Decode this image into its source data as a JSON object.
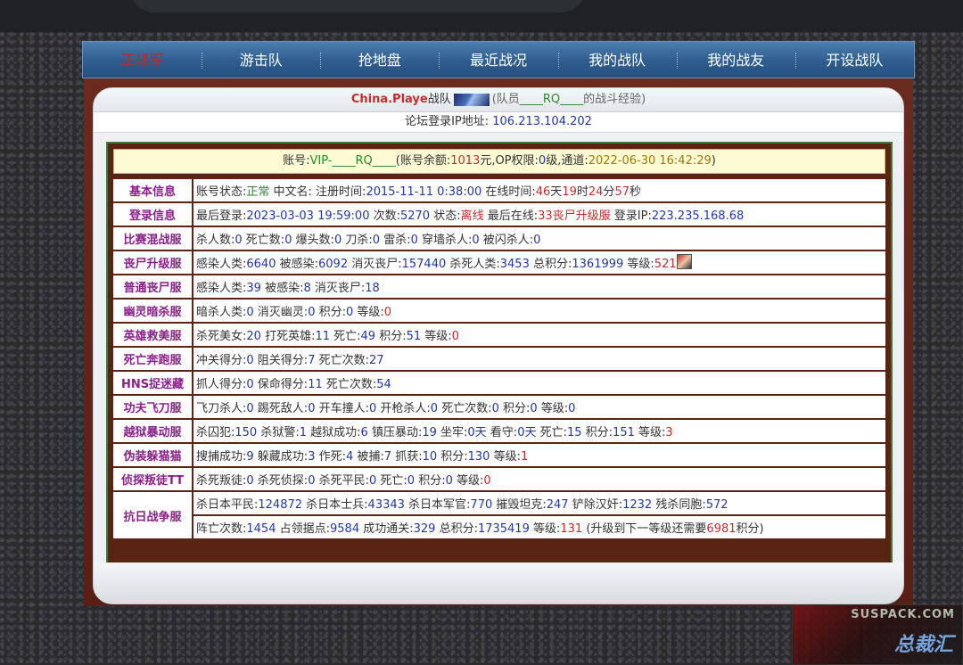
{
  "nav": [
    "正规军",
    "游击队",
    "抢地盘",
    "最近战况",
    "我的战队",
    "我的战友",
    "开设战队"
  ],
  "header": {
    "name": "China.Playe",
    "team": "战队",
    "prefix": "(队员",
    "member": "____RQ____",
    "suffix": "的战斗经验)"
  },
  "ip": {
    "label": "论坛登录IP地址:",
    "value": "106.213.104.202"
  },
  "account": {
    "l1": "账号:",
    "id": "VIP-____RQ____",
    "l2": "(账号余额:",
    "balance": "1013",
    "l3": "元,OP权限:",
    "op": "0",
    "l4": "级,通道:",
    "time": "2022-06-30 16:42:29",
    "l5": ")"
  },
  "rows": [
    {
      "label": "基本信息",
      "parts": [
        [
          "t",
          "账号状态:"
        ],
        [
          "g",
          "正常"
        ],
        [
          "t",
          " 中文名: 注册时间:"
        ],
        [
          "n",
          "2015-11-11 0:38:00"
        ],
        [
          "t",
          " 在线时间:"
        ],
        [
          "r",
          "46"
        ],
        [
          "t",
          "天"
        ],
        [
          "r",
          "19"
        ],
        [
          "t",
          "时"
        ],
        [
          "r",
          "24"
        ],
        [
          "t",
          "分"
        ],
        [
          "r",
          "57"
        ],
        [
          "t",
          "秒"
        ]
      ]
    },
    {
      "label": "登录信息",
      "parts": [
        [
          "t",
          "最后登录:"
        ],
        [
          "n",
          "2023-03-03 19:59:00"
        ],
        [
          "t",
          " 次数:"
        ],
        [
          "n",
          "5270"
        ],
        [
          "t",
          " 状态:"
        ],
        [
          "r",
          "离线"
        ],
        [
          "t",
          " 最后在线:"
        ],
        [
          "r",
          "33丧尸升级服"
        ],
        [
          "t",
          " 登录IP:"
        ],
        [
          "n",
          "223.235.168.68"
        ]
      ]
    },
    {
      "label": "比赛混战服",
      "parts": [
        [
          "t",
          "杀人数:"
        ],
        [
          "n",
          "0"
        ],
        [
          "t",
          " 死亡数:"
        ],
        [
          "n",
          "0"
        ],
        [
          "t",
          " 爆头数:"
        ],
        [
          "n",
          "0"
        ],
        [
          "t",
          " 刀杀:"
        ],
        [
          "n",
          "0"
        ],
        [
          "t",
          " 雷杀:"
        ],
        [
          "n",
          "0"
        ],
        [
          "t",
          " 穿墙杀人:"
        ],
        [
          "n",
          "0"
        ],
        [
          "t",
          " 被闪杀人:"
        ],
        [
          "n",
          "0"
        ]
      ]
    },
    {
      "label": "丧尸升级服",
      "parts": [
        [
          "t",
          "感染人类:"
        ],
        [
          "n",
          "6640"
        ],
        [
          "t",
          " 被感染:"
        ],
        [
          "n",
          "6092"
        ],
        [
          "t",
          " 消灭丧尸:"
        ],
        [
          "n",
          "157440"
        ],
        [
          "t",
          " 杀死人类:"
        ],
        [
          "n",
          "3453"
        ],
        [
          "t",
          " 总积分:"
        ],
        [
          "n",
          "1361999"
        ],
        [
          "t",
          " 等级:"
        ],
        [
          "r",
          "521"
        ],
        [
          "a",
          ""
        ]
      ]
    },
    {
      "label": "普通丧尸服",
      "parts": [
        [
          "t",
          "感染人类:"
        ],
        [
          "n",
          "39"
        ],
        [
          "t",
          " 被感染:"
        ],
        [
          "n",
          "8"
        ],
        [
          "t",
          " 消灭丧尸:"
        ],
        [
          "n",
          "18"
        ]
      ]
    },
    {
      "label": "幽灵暗杀服",
      "parts": [
        [
          "t",
          "暗杀人类:"
        ],
        [
          "n",
          "0"
        ],
        [
          "t",
          " 消灭幽灵:"
        ],
        [
          "n",
          "0"
        ],
        [
          "t",
          " 积分:"
        ],
        [
          "n",
          "0"
        ],
        [
          "t",
          " 等级:"
        ],
        [
          "r",
          "0"
        ]
      ]
    },
    {
      "label": "英雄救美服",
      "parts": [
        [
          "t",
          "杀死美女:"
        ],
        [
          "n",
          "20"
        ],
        [
          "t",
          " 打死英雄:"
        ],
        [
          "n",
          "11"
        ],
        [
          "t",
          " 死亡:"
        ],
        [
          "n",
          "49"
        ],
        [
          "t",
          " 积分:"
        ],
        [
          "n",
          "51"
        ],
        [
          "t",
          " 等级:"
        ],
        [
          "r",
          "0"
        ]
      ]
    },
    {
      "label": "死亡奔跑服",
      "parts": [
        [
          "t",
          "冲关得分:"
        ],
        [
          "n",
          "0"
        ],
        [
          "t",
          " 阻关得分:"
        ],
        [
          "n",
          "7"
        ],
        [
          "t",
          " 死亡次数:"
        ],
        [
          "n",
          "27"
        ]
      ]
    },
    {
      "label": "HNS捉迷藏",
      "parts": [
        [
          "t",
          "抓人得分:"
        ],
        [
          "n",
          "0"
        ],
        [
          "t",
          " 保命得分:"
        ],
        [
          "n",
          "11"
        ],
        [
          "t",
          " 死亡次数:"
        ],
        [
          "n",
          "54"
        ]
      ]
    },
    {
      "label": "功夫飞刀服",
      "parts": [
        [
          "t",
          "飞刀杀人:"
        ],
        [
          "n",
          "0"
        ],
        [
          "t",
          " 踢死敌人:"
        ],
        [
          "n",
          "0"
        ],
        [
          "t",
          " 开车撞人:"
        ],
        [
          "n",
          "0"
        ],
        [
          "t",
          " 开枪杀人:"
        ],
        [
          "n",
          "0"
        ],
        [
          "t",
          " 死亡次数:"
        ],
        [
          "n",
          "0"
        ],
        [
          "t",
          " 积分:"
        ],
        [
          "n",
          "0"
        ],
        [
          "t",
          " 等级:"
        ],
        [
          "n",
          "0"
        ]
      ]
    },
    {
      "label": "越狱暴动服",
      "parts": [
        [
          "t",
          "杀囚犯:"
        ],
        [
          "n",
          "150"
        ],
        [
          "t",
          " 杀狱警:"
        ],
        [
          "n",
          "1"
        ],
        [
          "t",
          " 越狱成功:"
        ],
        [
          "n",
          "6"
        ],
        [
          "t",
          " 镇压暴动:"
        ],
        [
          "n",
          "19"
        ],
        [
          "t",
          " 坐牢:"
        ],
        [
          "n",
          "0天"
        ],
        [
          "t",
          " 看守:"
        ],
        [
          "n",
          "0天"
        ],
        [
          "t",
          " 死亡:"
        ],
        [
          "n",
          "15"
        ],
        [
          "t",
          " 积分:"
        ],
        [
          "n",
          "151"
        ],
        [
          "t",
          " 等级:"
        ],
        [
          "r",
          "3"
        ]
      ]
    },
    {
      "label": "伪装躲猫猫",
      "parts": [
        [
          "t",
          "搜捕成功:"
        ],
        [
          "n",
          "9"
        ],
        [
          "t",
          " 躲藏成功:"
        ],
        [
          "n",
          "3"
        ],
        [
          "t",
          " 作死:"
        ],
        [
          "n",
          "4"
        ],
        [
          "t",
          " 被捕:"
        ],
        [
          "n",
          "7"
        ],
        [
          "t",
          " 抓获:"
        ],
        [
          "n",
          "10"
        ],
        [
          "t",
          " 积分:"
        ],
        [
          "n",
          "130"
        ],
        [
          "t",
          " 等级:"
        ],
        [
          "r",
          "1"
        ]
      ]
    },
    {
      "label": "侦探叛徒TT",
      "parts": [
        [
          "t",
          "杀死叛徒:"
        ],
        [
          "n",
          "0"
        ],
        [
          "t",
          " 杀死侦探:"
        ],
        [
          "n",
          "0"
        ],
        [
          "t",
          " 杀死平民:"
        ],
        [
          "n",
          "0"
        ],
        [
          "t",
          " 死亡:"
        ],
        [
          "n",
          "0"
        ],
        [
          "t",
          " 积分:"
        ],
        [
          "n",
          "0"
        ],
        [
          "t",
          " 等级:"
        ],
        [
          "r",
          "0"
        ]
      ]
    }
  ],
  "war": {
    "label": "抗日战争服",
    "line1": [
      [
        "t",
        "杀日本平民:"
      ],
      [
        "n",
        "124872"
      ],
      [
        "t",
        " 杀日本士兵:"
      ],
      [
        "n",
        "43343"
      ],
      [
        "t",
        " 杀日本军官:"
      ],
      [
        "n",
        "770"
      ],
      [
        "t",
        " 摧毁坦克:"
      ],
      [
        "n",
        "247"
      ],
      [
        "t",
        " 铲除汉奸:"
      ],
      [
        "n",
        "1232"
      ],
      [
        "t",
        " 残杀同胞:"
      ],
      [
        "n",
        "572"
      ]
    ],
    "line2": [
      [
        "t",
        "阵亡次数:"
      ],
      [
        "n",
        "1454"
      ],
      [
        "t",
        " 占领据点:"
      ],
      [
        "n",
        "9584"
      ],
      [
        "t",
        " 成功通关:"
      ],
      [
        "n",
        "329"
      ],
      [
        "t",
        " 总积分:"
      ],
      [
        "n",
        "1735419"
      ],
      [
        "t",
        " 等级:"
      ],
      [
        "r",
        "131"
      ],
      [
        "t",
        " (升级到下一等级还需要"
      ],
      [
        "r",
        "6981"
      ],
      [
        "t",
        "积分)"
      ]
    ]
  },
  "watermark": {
    "top": "SUSPACK.COM",
    "bottom": "总裁汇"
  }
}
